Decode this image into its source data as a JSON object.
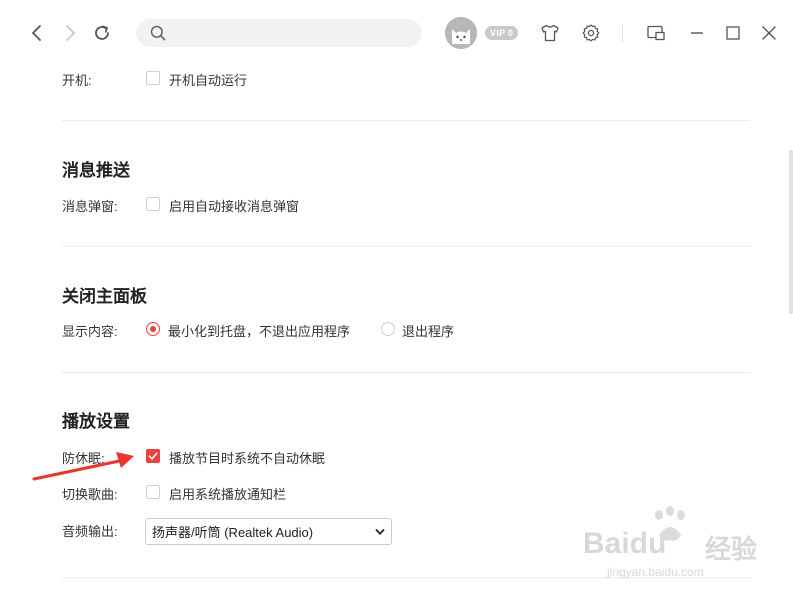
{
  "toolbar": {
    "search": {
      "value": "",
      "placeholder": ""
    },
    "vip_badge": "VIP 0",
    "icons": [
      "back-icon",
      "forward-icon",
      "refresh-icon",
      "search-icon",
      "avatar-cat-icon",
      "skin-shirt-icon",
      "settings-gear-icon",
      "mini-player-icon",
      "minimize-icon",
      "maximize-icon",
      "close-icon"
    ]
  },
  "settings": {
    "startup": {
      "label": "开机:",
      "option": {
        "text": "开机自动运行",
        "checked": false
      }
    },
    "push": {
      "title": "消息推送",
      "label": "消息弹窗:",
      "option": {
        "text": "启用自动接收消息弹窗",
        "checked": false
      }
    },
    "close_panel": {
      "title": "关闭主面板",
      "label": "显示内容:",
      "options": [
        {
          "text": "最小化到托盘，不退出应用程序",
          "checked": true
        },
        {
          "text": "退出程序",
          "checked": false
        }
      ]
    },
    "playback": {
      "title": "播放设置",
      "anti_sleep": {
        "label": "防休眠:",
        "option": {
          "text": "播放节目时系统不自动休眠",
          "checked": true
        }
      },
      "switch_song": {
        "label": "切换歌曲:",
        "option": {
          "text": "启用系统播放通知栏",
          "checked": false
        }
      },
      "audio_output": {
        "label": "音频输出:",
        "selected": "扬声器/听筒 (Realtek Audio)"
      }
    }
  },
  "colors": {
    "accent": "#ec4141",
    "annotation_arrow": "#e8362d"
  },
  "watermark": {
    "brand": "Baidu",
    "cn": "经验",
    "url": "jingyan.baidu.com"
  }
}
